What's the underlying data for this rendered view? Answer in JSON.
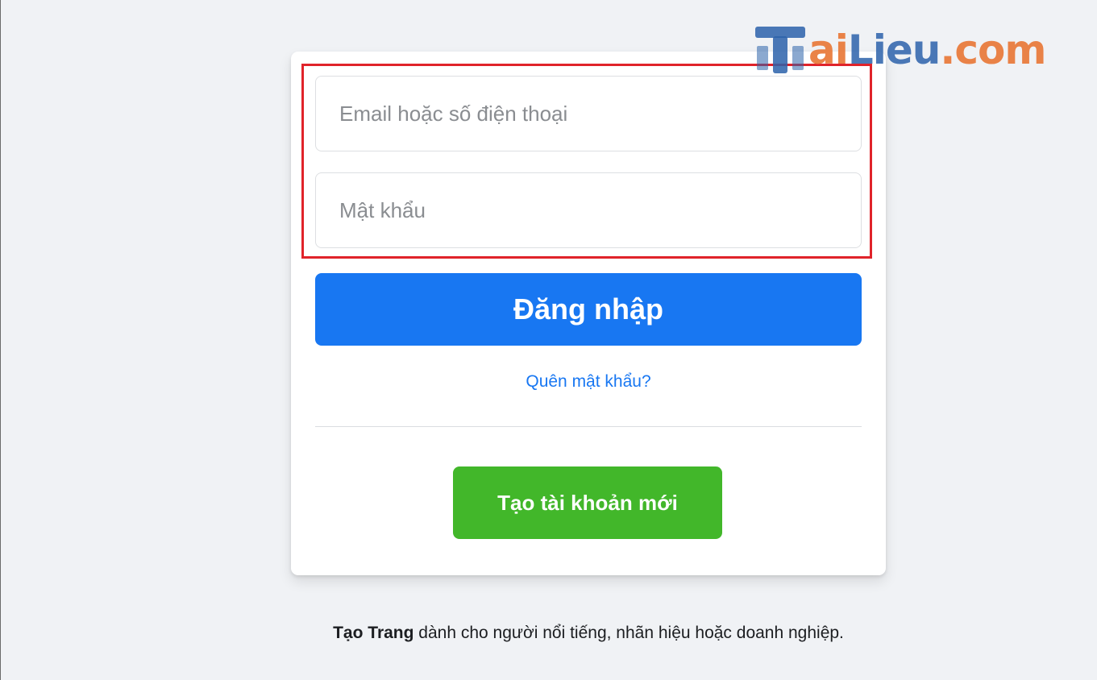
{
  "login_form": {
    "email_placeholder": "Email hoặc số điện thoại",
    "email_value": "",
    "password_placeholder": "Mật khẩu",
    "password_value": "",
    "login_button_label": "Đăng nhập",
    "forgot_password_label": "Quên mật khẩu?",
    "create_account_label": "Tạo tài khoản mới"
  },
  "footer": {
    "create_page_link_label": "Tạo Trang",
    "create_page_text": " dành cho người nổi tiếng, nhãn hiệu hoặc doanh nghiệp."
  },
  "watermark": {
    "part_ai": "ai",
    "part_lieu": "Lieu",
    "part_dot": ".",
    "part_com": "com"
  },
  "colors": {
    "background": "#f0f2f5",
    "primary_button": "#1877f2",
    "create_button": "#42b72a",
    "highlight_box": "#e0232a",
    "link": "#1877f2"
  },
  "icons": {
    "watermark_logo": "tailieu-logo-icon"
  }
}
